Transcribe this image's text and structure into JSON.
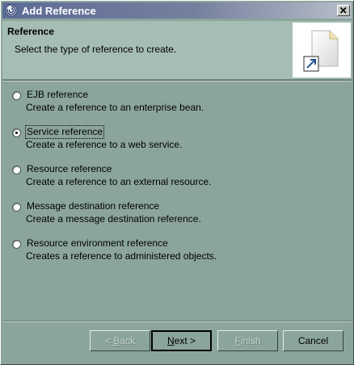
{
  "window": {
    "title": "Add Reference",
    "accent": "#5d6c97",
    "background": "#8ba59c"
  },
  "header": {
    "title": "Reference",
    "description": "Select the type of reference to create.",
    "banner_icon": "new-reference-wizard-icon"
  },
  "options": [
    {
      "label": "EJB reference",
      "description": "Create a reference to an enterprise bean.",
      "selected": false
    },
    {
      "label": "Service reference",
      "description": "Create a reference to a web service.",
      "selected": true
    },
    {
      "label": "Resource reference",
      "description": "Create a reference to an external resource.",
      "selected": false
    },
    {
      "label": "Message destination reference",
      "description": "Create a message destination reference.",
      "selected": false
    },
    {
      "label": "Resource environment reference",
      "description": "Creates a reference to administered objects.",
      "selected": false
    }
  ],
  "buttons": {
    "back_prefix": "< ",
    "back_mnemonic": "B",
    "back_rest": "ack",
    "next_mnemonic": "N",
    "next_rest": "ext >",
    "finish_mnemonic": "F",
    "finish_rest": "inish",
    "cancel": "Cancel"
  }
}
